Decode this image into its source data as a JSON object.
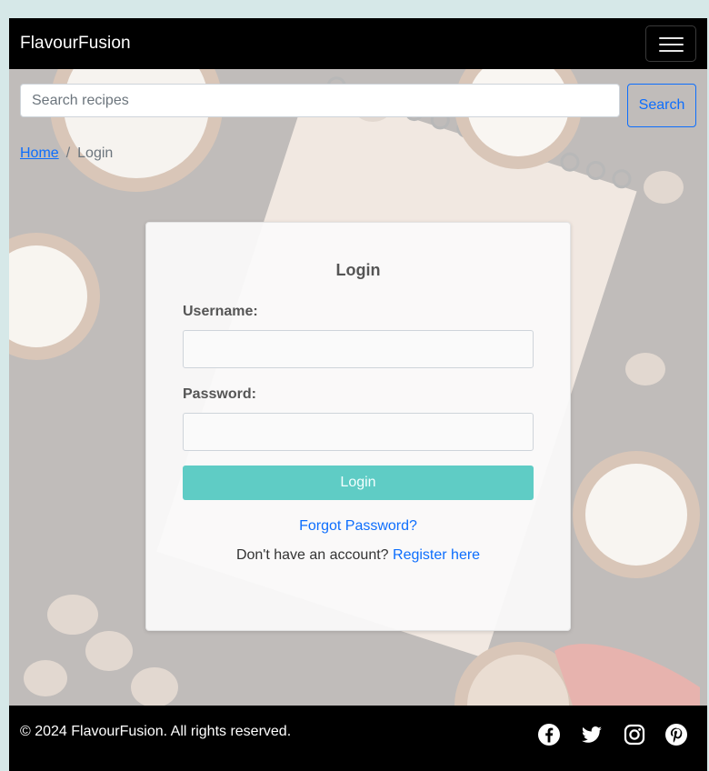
{
  "navbar": {
    "brand": "FlavourFusion",
    "toggler_icon": "hamburger-menu-icon"
  },
  "search": {
    "placeholder": "Search recipes",
    "value": "",
    "button_label": "Search"
  },
  "breadcrumb": {
    "home": "Home",
    "separator": "/",
    "current": "Login"
  },
  "login_card": {
    "title": "Login",
    "username_label": "Username:",
    "username_value": "",
    "password_label": "Password:",
    "password_value": "",
    "submit_label": "Login",
    "forgot_link": "Forgot Password?",
    "register_prompt": "Don't have an account?",
    "register_link": "Register here"
  },
  "footer": {
    "copyright": "© 2024 FlavourFusion. All rights reserved.",
    "social": [
      {
        "icon": "facebook-icon"
      },
      {
        "icon": "twitter-icon"
      },
      {
        "icon": "instagram-icon"
      },
      {
        "icon": "pinterest-icon"
      }
    ]
  },
  "colors": {
    "accent": "#0d6efd",
    "login_button": "#5fccc5",
    "navbar": "#000000"
  }
}
